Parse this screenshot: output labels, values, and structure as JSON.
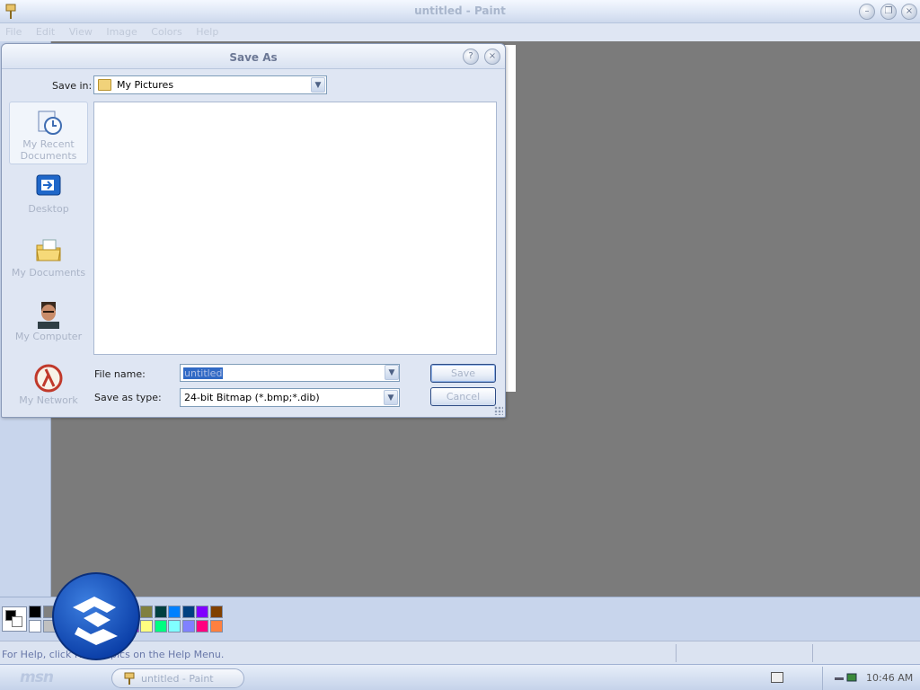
{
  "window": {
    "title": "untitled - Paint",
    "menu": [
      "File",
      "Edit",
      "View",
      "Image",
      "Colors",
      "Help"
    ],
    "controls": {
      "minimize": "–",
      "restore": "❐",
      "close": "×"
    }
  },
  "dialog": {
    "title": "Save As",
    "help_glyph": "?",
    "close_glyph": "×",
    "save_in_label": "Save in:",
    "save_in_value": "My Pictures",
    "toolbar": [
      {
        "name": "back-icon",
        "glyph": "◀"
      },
      {
        "name": "up-folder-icon",
        "glyph": "⬆"
      },
      {
        "name": "new-folder-icon",
        "glyph": "✚"
      },
      {
        "name": "view-menu-icon",
        "glyph": "▦"
      }
    ],
    "places": [
      {
        "label": "My Recent Documents",
        "icon": "recent-documents-icon"
      },
      {
        "label": "Desktop",
        "icon": "desktop-icon"
      },
      {
        "label": "My Documents",
        "icon": "my-documents-icon"
      },
      {
        "label": "My Computer",
        "icon": "my-computer-icon"
      },
      {
        "label": "My Network",
        "icon": "my-network-icon"
      }
    ],
    "file_name_label": "File name:",
    "file_name_value": "untitled",
    "save_as_type_label": "Save as type:",
    "save_as_type_value": "24-bit Bitmap (*.bmp;*.dib)",
    "save_button": "Save",
    "cancel_button": "Cancel"
  },
  "palette": {
    "colors_top": [
      "#000000",
      "#808080",
      "#800000",
      "#808000",
      "#008000",
      "#008080",
      "#000080",
      "#800080",
      "#808040",
      "#004040",
      "#0080ff",
      "#004080",
      "#8000ff",
      "#804000"
    ],
    "colors_bottom": [
      "#ffffff",
      "#c0c0c0",
      "#ff0000",
      "#ffff00",
      "#00ff00",
      "#00ffff",
      "#0000ff",
      "#ff00ff",
      "#ffff80",
      "#00ff80",
      "#80ffff",
      "#8080ff",
      "#ff0080",
      "#ff8040"
    ]
  },
  "status": {
    "help_text": "For Help, click Help Topics on the Help Menu."
  },
  "taskbar": {
    "logo": "msn",
    "task_label": "untitled - Paint",
    "clock": "10:46 AM"
  }
}
